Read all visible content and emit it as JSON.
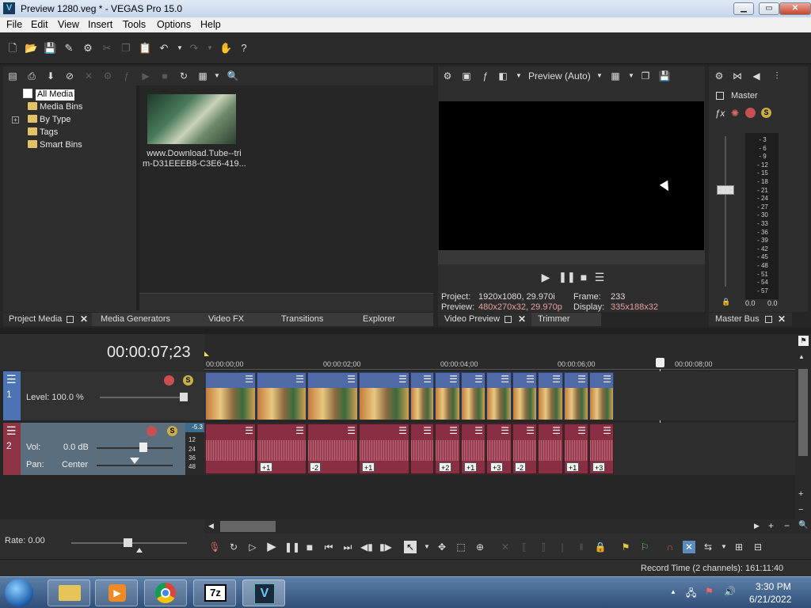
{
  "window": {
    "title": "Preview 1280.veg * - VEGAS Pro 15.0",
    "minimize": "▁",
    "maximize": "▭",
    "close": "✕"
  },
  "menu": [
    "File",
    "Edit",
    "View",
    "Insert",
    "Tools",
    "Options",
    "Help"
  ],
  "project_media": {
    "tree": [
      "All Media",
      "Media Bins",
      "By Type",
      "Tags",
      "Smart Bins"
    ],
    "thumb_caption_1": "www.Download.Tube--tri",
    "thumb_caption_2": "m-D31EEEB8-C3E6-419..."
  },
  "tabs_left": {
    "project_media": "Project Media",
    "media_generators": "Media Generators",
    "video_fx": "Video FX",
    "transitions": "Transitions",
    "explorer": "Explorer"
  },
  "preview": {
    "mode": "Preview (Auto)",
    "project_label": "Project:",
    "project_value": "1920x1080, 29.970i",
    "preview_label": "Preview:",
    "preview_value": "480x270x32, 29.970p",
    "frame_label": "Frame:",
    "frame_value": "233",
    "display_label": "Display:",
    "display_value": "335x188x32",
    "tab_video_preview": "Video Preview",
    "tab_trimmer": "Trimmer"
  },
  "master": {
    "label": "Master",
    "tab": "Master Bus",
    "scale": [
      "3",
      "6",
      "9",
      "12",
      "15",
      "18",
      "21",
      "24",
      "27",
      "30",
      "33",
      "36",
      "39",
      "42",
      "45",
      "48",
      "51",
      "54",
      "57"
    ],
    "left_value": "0.0",
    "right_value": "0.0"
  },
  "timeline": {
    "timecode": "00:00:07;23",
    "ruler": [
      "00:00:00;00",
      "00:00:02;00",
      "00:00:04;00",
      "00:00:06;00",
      "00:00:08;00"
    ],
    "video_track": {
      "number": "1",
      "level": "Level: 100.0 %"
    },
    "audio_track": {
      "number": "2",
      "vol_label": "Vol:",
      "vol_value": "0.0 dB",
      "pan_label": "Pan:",
      "pan_value": "Center",
      "peak": "-5.3",
      "scale": [
        "12",
        "24",
        "36",
        "48"
      ]
    },
    "audio_offsets": [
      "+1",
      "-2",
      "+1",
      "+2",
      "+1",
      "+3",
      "-2",
      "+1",
      "+3"
    ],
    "rate": "Rate: 0.00"
  },
  "status": {
    "record_time": "Record Time (2 channels): 161:11:40"
  },
  "taskbar": {
    "time": "3:30 PM",
    "date": "6/21/2022",
    "sevenzip": "7z",
    "vegas": "V"
  },
  "colors": {
    "video_header": "#4c74b5",
    "audio_header": "#8e3344",
    "video_clip_top": "#4f6aa6",
    "audio_clip": "#8a2f43"
  }
}
